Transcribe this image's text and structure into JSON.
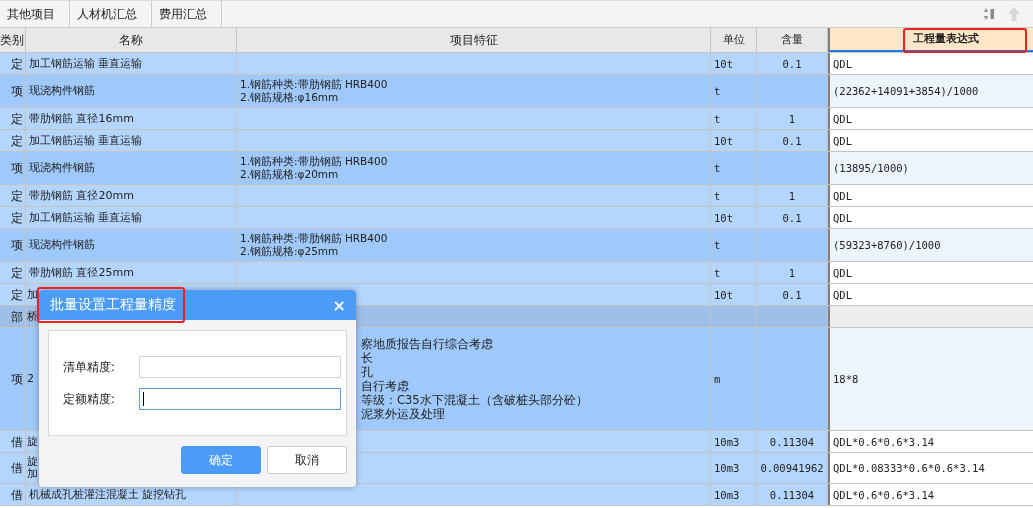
{
  "tabs": [
    {
      "label": "其他项目"
    },
    {
      "label": "人材机汇总"
    },
    {
      "label": "费用汇总"
    }
  ],
  "table": {
    "columns": [
      {
        "label": "类别",
        "selected": false
      },
      {
        "label": "名称",
        "selected": false
      },
      {
        "label": "项目特征",
        "selected": false
      },
      {
        "label": "单位",
        "selected": false
      },
      {
        "label": "含量",
        "selected": false
      },
      {
        "label": "工程量表达式",
        "selected": true
      }
    ],
    "rows": [
      {
        "kind": "quota",
        "type": "定",
        "name": "加工钢筋运输 垂直运输",
        "feature": [],
        "unit": "10t",
        "qty": "0.1",
        "expr": "QDL"
      },
      {
        "kind": "item",
        "type": "项",
        "name": "现浇构件钢筋",
        "feature": [
          "1.钢筋种类:带肋钢筋 HRB400",
          "2.钢筋规格:φ16mm"
        ],
        "unit": "t",
        "qty": "",
        "expr": "(22362+14091+3854)/1000"
      },
      {
        "kind": "quota",
        "type": "定",
        "name": "带肋钢筋 直径16mm",
        "feature": [],
        "unit": "t",
        "qty": "1",
        "expr": "QDL"
      },
      {
        "kind": "quota",
        "type": "定",
        "name": "加工钢筋运输 垂直运输",
        "feature": [],
        "unit": "10t",
        "qty": "0.1",
        "expr": "QDL"
      },
      {
        "kind": "item",
        "type": "项",
        "name": "现浇构件钢筋",
        "feature": [
          "1.钢筋种类:带肋钢筋 HRB400",
          "2.钢筋规格:φ20mm"
        ],
        "unit": "t",
        "qty": "",
        "expr": "(13895/1000)"
      },
      {
        "kind": "quota",
        "type": "定",
        "name": "带肋钢筋 直径20mm",
        "feature": [],
        "unit": "t",
        "qty": "1",
        "expr": "QDL"
      },
      {
        "kind": "quota",
        "type": "定",
        "name": "加工钢筋运输 垂直运输",
        "feature": [],
        "unit": "10t",
        "qty": "0.1",
        "expr": "QDL"
      },
      {
        "kind": "item",
        "type": "项",
        "name": "现浇构件钢筋",
        "feature": [
          "1.钢筋种类:带肋钢筋 HRB400",
          "2.钢筋规格:φ25mm"
        ],
        "unit": "t",
        "qty": "",
        "expr": "(59323+8760)/1000"
      },
      {
        "kind": "quota",
        "type": "定",
        "name": "带肋钢筋 直径25mm",
        "feature": [],
        "unit": "t",
        "qty": "1",
        "expr": "QDL"
      },
      {
        "kind": "quota",
        "type": "定",
        "name": "加",
        "feature": [],
        "unit": "10t",
        "qty": "0.1",
        "expr": "QDL",
        "covered": true
      },
      {
        "kind": "section",
        "type": "部",
        "name": "桥",
        "feature": [],
        "unit": "",
        "qty": "",
        "expr": "",
        "covered": true
      },
      {
        "kind": "item",
        "type": "项",
        "name": "2",
        "feature": [
          "察地质报告自行综合考虑",
          "长",
          "孔",
          "自行考虑",
          "等级：C35水下混凝土（含破桩头部分砼）",
          "泥浆外运及处理"
        ],
        "unit": "m",
        "qty": "",
        "expr": "18*8",
        "covered": true
      },
      {
        "kind": "quota",
        "type": "借",
        "name": "旋",
        "feature": [],
        "unit": "10m3",
        "qty": "0.11304",
        "expr": "QDL*0.6*0.6*3.14",
        "covered": true
      },
      {
        "kind": "quota",
        "type": "借",
        "name": "旋加",
        "feature": [],
        "unit": "10m3",
        "qty": "0.00941962",
        "expr": "QDL*0.08333*0.6*0.6*3.14",
        "covered": true
      },
      {
        "kind": "quota",
        "type": "借",
        "name": "机械成孔桩灌注混凝土 旋挖钻孔",
        "feature": [],
        "unit": "10m3",
        "qty": "0.11304",
        "expr": "QDL*0.6*0.6*3.14"
      }
    ]
  },
  "dialog": {
    "title": "批量设置工程量精度",
    "close": "×",
    "fields": [
      {
        "label": "清单精度:",
        "focused": false
      },
      {
        "label": "定额精度:",
        "focused": true
      }
    ],
    "buttons": [
      {
        "label": "确定",
        "kind": "primary"
      },
      {
        "label": "取消",
        "kind": "secondary"
      }
    ]
  }
}
